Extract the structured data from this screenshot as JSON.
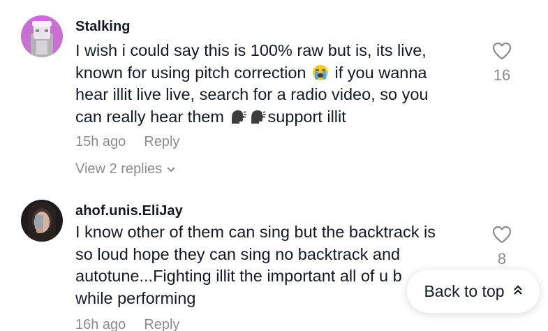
{
  "comments": [
    {
      "username": "Stalking",
      "text_lines": [
        [
          "I wish i could say this is 100% raw but is, its live,"
        ],
        [
          "known for using pitch correction ",
          "if you wanna"
        ],
        [
          "hear illit live live, search for a radio video, so you"
        ],
        [
          "can really hear them ",
          "support illit"
        ]
      ],
      "time": "15h ago",
      "reply_label": "Reply",
      "view_replies": "View 2 replies",
      "like_count": "16"
    },
    {
      "username": "ahof.unis.EliJay",
      "text_lines": [
        "I know other of them can sing but the backtrack is",
        "so loud hope they can sing no backtrack and",
        "autotune...Fighting illit the important all of u b",
        "while performing"
      ],
      "time": "16h ago",
      "reply_label": "Reply",
      "like_count": "8"
    }
  ],
  "back_to_top": {
    "label": "Back to top",
    "icon": "double-chevron-up-icon"
  },
  "emojis": {
    "crying": "loudly-crying-face-emoji",
    "speaking": "speaking-head-emoji"
  },
  "colors": {
    "text_primary": "#161823",
    "text_secondary": "#8A8B91"
  }
}
